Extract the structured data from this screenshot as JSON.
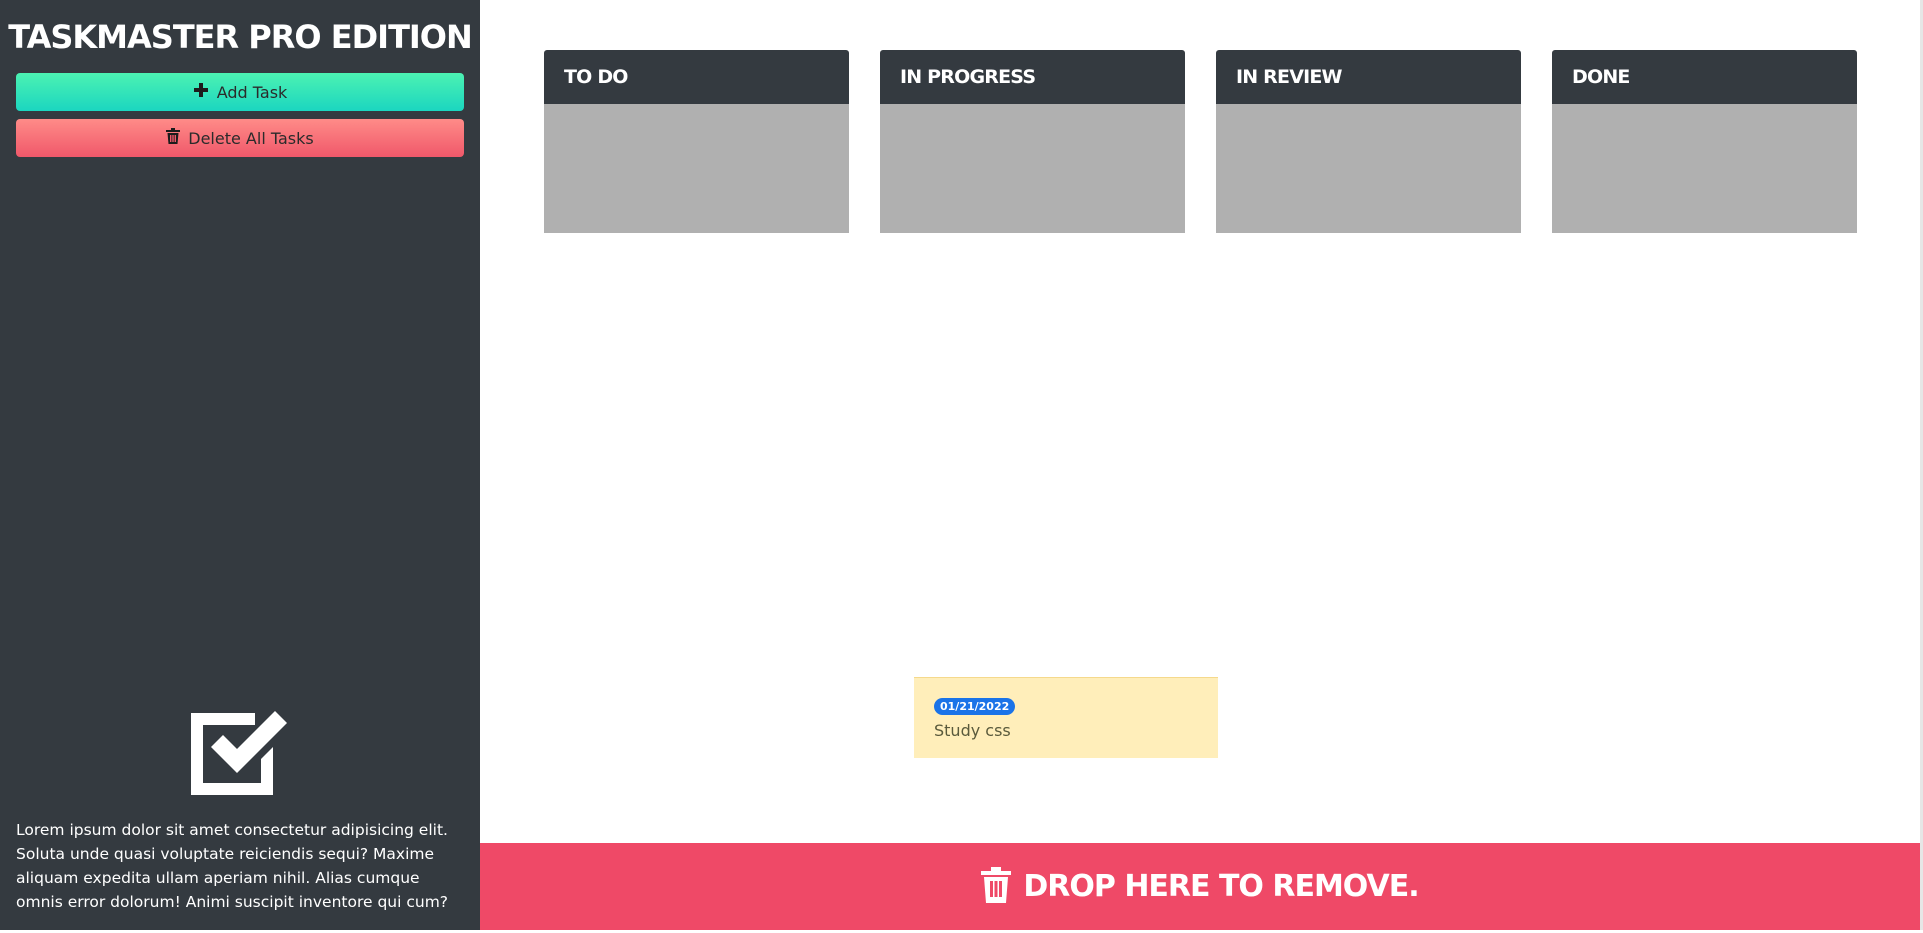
{
  "sidebar": {
    "title": "TASKMASTER PRO EDITION",
    "add_button": "Add Task",
    "delete_button": "Delete All Tasks",
    "about": "Lorem ipsum dolor sit amet consectetur adipisicing elit. Soluta unde quasi voluptate reiciendis sequi? Maxime aliquam expedita ullam aperiam nihil. Alias cumque omnis error dolorum! Animi suscipit inventore qui cum?",
    "logo_icon": "checkbox-checked-icon"
  },
  "columns": [
    {
      "title": "TO DO"
    },
    {
      "title": "IN PROGRESS"
    },
    {
      "title": "IN REVIEW"
    },
    {
      "title": "DONE"
    }
  ],
  "card": {
    "date": "01/21/2022",
    "text": "Study css"
  },
  "dropzone": {
    "label": "DROP HERE TO REMOVE.",
    "icon": "trash-icon"
  },
  "colors": {
    "sidebar": "#343a40",
    "add_button": "#1bd6c0",
    "delete_button": "#f0586a",
    "column_body": "#b0b0b0",
    "card": "#ffeeba",
    "badge": "#1a73e8",
    "dropzone": "#ef4967"
  }
}
